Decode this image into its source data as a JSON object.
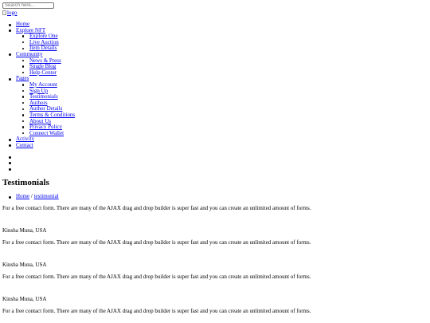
{
  "search": {
    "placeholder": "Search here..."
  },
  "logo": {
    "alt": "logo"
  },
  "nav": {
    "home": "Home",
    "explore": {
      "label": "Explore NFT",
      "items": [
        "Explore One",
        "Live Auction",
        "Item Details"
      ]
    },
    "community": {
      "label": "Community",
      "items": [
        "News & Press",
        "Single Blog",
        "Help Center"
      ]
    },
    "pages": {
      "label": "Pages",
      "items": [
        "My Account",
        "Sign Up",
        "Testimonials",
        "Authors",
        "Author Details",
        "Terms & Conditions",
        "About Us",
        "Privacy Policy",
        "Connect Wallet"
      ]
    },
    "activity": "Activity",
    "contact": "Contact"
  },
  "page_title": "Testimonials",
  "breadcrumb": {
    "home": "Home",
    "separator": "/",
    "current": "testimonial"
  },
  "testimonials": [
    {
      "text": "For a free contact form. There are many of the AJAX drag and drop builder is super fast and you can create an unlimited amount of forms.",
      "author": "Kinsha Muna, USA"
    },
    {
      "text": "For a free contact form. There are many of the AJAX drag and drop builder is super fast and you can create an unlimited amount of forms.",
      "author": "Kinsha Muna, USA"
    },
    {
      "text": "For a free contact form. There are many of the AJAX drag and drop builder is super fast and you can create an unlimited amount of forms.",
      "author": "Kinsha Muna, USA"
    },
    {
      "text": "For a free contact form. There are many of the AJAX drag and drop builder is super fast and you can create an unlimited amount of forms."
    }
  ]
}
